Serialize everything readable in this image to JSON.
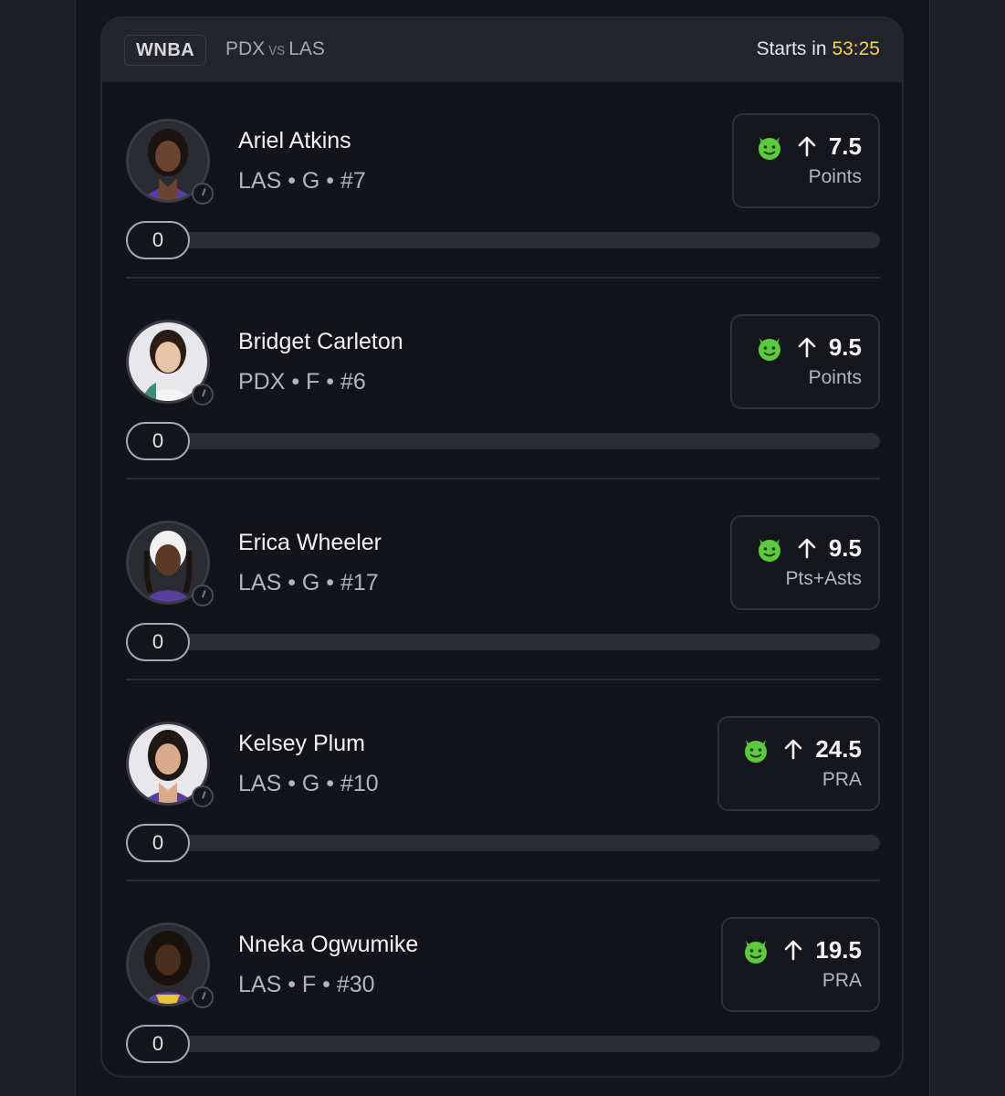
{
  "header": {
    "league": "WNBA",
    "away_team": "PDX",
    "vs": "vs",
    "home_team": "LAS",
    "starts_label": "Starts in",
    "countdown": "53:25"
  },
  "colors": {
    "countdown": "#f4d24a",
    "emoji_green": "#5cc93e"
  },
  "players": [
    {
      "name": "Ariel Atkins",
      "team": "LAS",
      "position": "G",
      "number": "#7",
      "meta": "LAS • G • #7",
      "icon": "devil-emoji-icon",
      "direction": "up-arrow-icon",
      "line": "7.5",
      "stat": "Points",
      "progress_value": "0"
    },
    {
      "name": "Bridget Carleton",
      "team": "PDX",
      "position": "F",
      "number": "#6",
      "meta": "PDX • F • #6",
      "icon": "devil-emoji-icon",
      "direction": "up-arrow-icon",
      "line": "9.5",
      "stat": "Points",
      "progress_value": "0"
    },
    {
      "name": "Erica Wheeler",
      "team": "LAS",
      "position": "G",
      "number": "#17",
      "meta": "LAS • G • #17",
      "icon": "devil-emoji-icon",
      "direction": "up-arrow-icon",
      "line": "9.5",
      "stat": "Pts+Asts",
      "progress_value": "0"
    },
    {
      "name": "Kelsey Plum",
      "team": "LAS",
      "position": "G",
      "number": "#10",
      "meta": "LAS • G • #10",
      "icon": "devil-emoji-icon",
      "direction": "up-arrow-icon",
      "line": "24.5",
      "stat": "PRA",
      "progress_value": "0"
    },
    {
      "name": "Nneka Ogwumike",
      "team": "LAS",
      "position": "F",
      "number": "#30",
      "meta": "LAS • F • #30",
      "icon": "devil-emoji-icon",
      "direction": "up-arrow-icon",
      "line": "19.5",
      "stat": "PRA",
      "progress_value": "0"
    }
  ]
}
